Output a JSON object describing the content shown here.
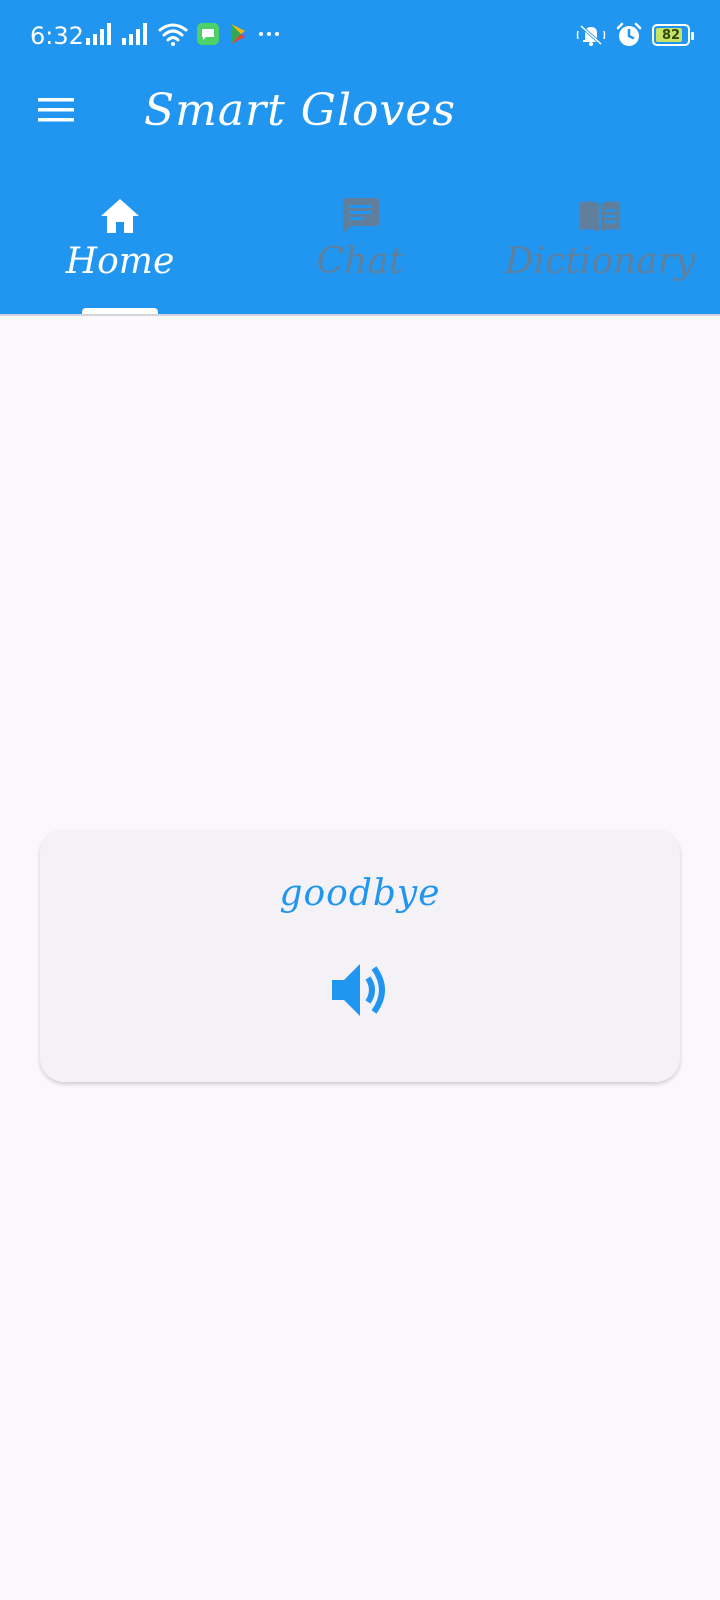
{
  "status_bar": {
    "time": "6:32",
    "battery_level": "82",
    "icons": [
      "signal-icon",
      "signal-icon",
      "wifi-icon",
      "message-app-icon",
      "play-store-icon",
      "more-icon",
      "mute-icon",
      "alarm-icon",
      "battery-icon"
    ]
  },
  "app_bar": {
    "title": "Smart Gloves",
    "menu_icon": "menu-icon"
  },
  "tabs": [
    {
      "label": "Home",
      "icon": "home-icon",
      "active": true
    },
    {
      "label": "Chat",
      "icon": "chat-icon",
      "active": false
    },
    {
      "label": "Dictionary",
      "icon": "book-icon",
      "active": false
    }
  ],
  "card": {
    "word": "goodbye",
    "speak_icon": "volume-icon"
  },
  "colors": {
    "primary": "#2196f0",
    "inactive_tab": "#5f7f9c",
    "background": "#fcf6fd",
    "card": "#f4f1f7"
  }
}
